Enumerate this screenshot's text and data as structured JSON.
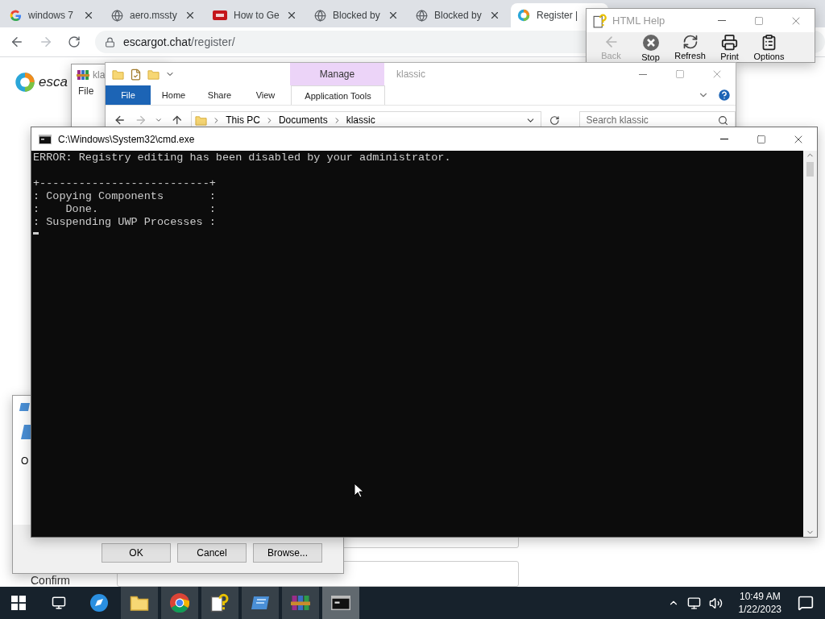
{
  "browser": {
    "tabs": [
      {
        "kind": "google",
        "label": "windows 7",
        "selected": false
      },
      {
        "kind": "globe",
        "label": "aero.mssty",
        "selected": false
      },
      {
        "kind": "video",
        "label": "How to Ge",
        "selected": false
      },
      {
        "kind": "globe",
        "label": "Blocked by",
        "selected": false
      },
      {
        "kind": "globe",
        "label": "Blocked by",
        "selected": false
      },
      {
        "kind": "escargot",
        "label": "Register |",
        "selected": true
      }
    ],
    "address": {
      "host": "escargot.chat",
      "path": "/register/"
    },
    "page": {
      "logo_text": "esca",
      "field_label": "Confirm"
    }
  },
  "run_dialog": {
    "label": "O",
    "buttons": [
      "OK",
      "Cancel",
      "Browse..."
    ]
  },
  "archive_window": {
    "title": "kla",
    "menu": [
      "File"
    ]
  },
  "help_window": {
    "title": "HTML Help",
    "toolbar": [
      {
        "kind": "back",
        "label": "Back",
        "disabled": true
      },
      {
        "kind": "stop",
        "label": "Stop",
        "disabled": false
      },
      {
        "kind": "refresh",
        "label": "Refresh",
        "disabled": false
      },
      {
        "kind": "print",
        "label": "Print",
        "disabled": false
      },
      {
        "kind": "options",
        "label": "Options",
        "disabled": false
      }
    ]
  },
  "explorer_window": {
    "context_tab": "Manage",
    "title": "klassic",
    "ribbon_tabs": [
      {
        "kind": "file",
        "label": "File"
      },
      {
        "kind": "tab",
        "label": "Home"
      },
      {
        "kind": "tab",
        "label": "Share"
      },
      {
        "kind": "tab",
        "label": "View"
      },
      {
        "kind": "context",
        "label": "Application Tools"
      }
    ],
    "breadcrumb": [
      "This PC",
      "Documents",
      "klassic"
    ],
    "search": {
      "placeholder": "Search klassic"
    }
  },
  "console_window": {
    "title": "C:\\Windows\\System32\\cmd.exe",
    "message": "ERROR: Registry editing has been disabled by your administrator.",
    "box_lines": [
      "+--------------------------+",
      ": Copying Components       :",
      ":    Done.                 :",
      ": Suspending UWP Processes :"
    ]
  },
  "taskbar": {
    "apps": [
      {
        "kind": "circle",
        "selected": false,
        "open": false
      },
      {
        "kind": "folder",
        "selected": false,
        "open": true
      },
      {
        "kind": "chrome",
        "selected": false,
        "open": true
      },
      {
        "kind": "help",
        "selected": false,
        "open": true
      },
      {
        "kind": "window",
        "selected": false,
        "open": true
      },
      {
        "kind": "archive",
        "selected": false,
        "open": true
      },
      {
        "kind": "console",
        "selected": true,
        "open": true
      }
    ],
    "clock": {
      "time": "10:49 AM",
      "date": "1/22/2023"
    }
  }
}
